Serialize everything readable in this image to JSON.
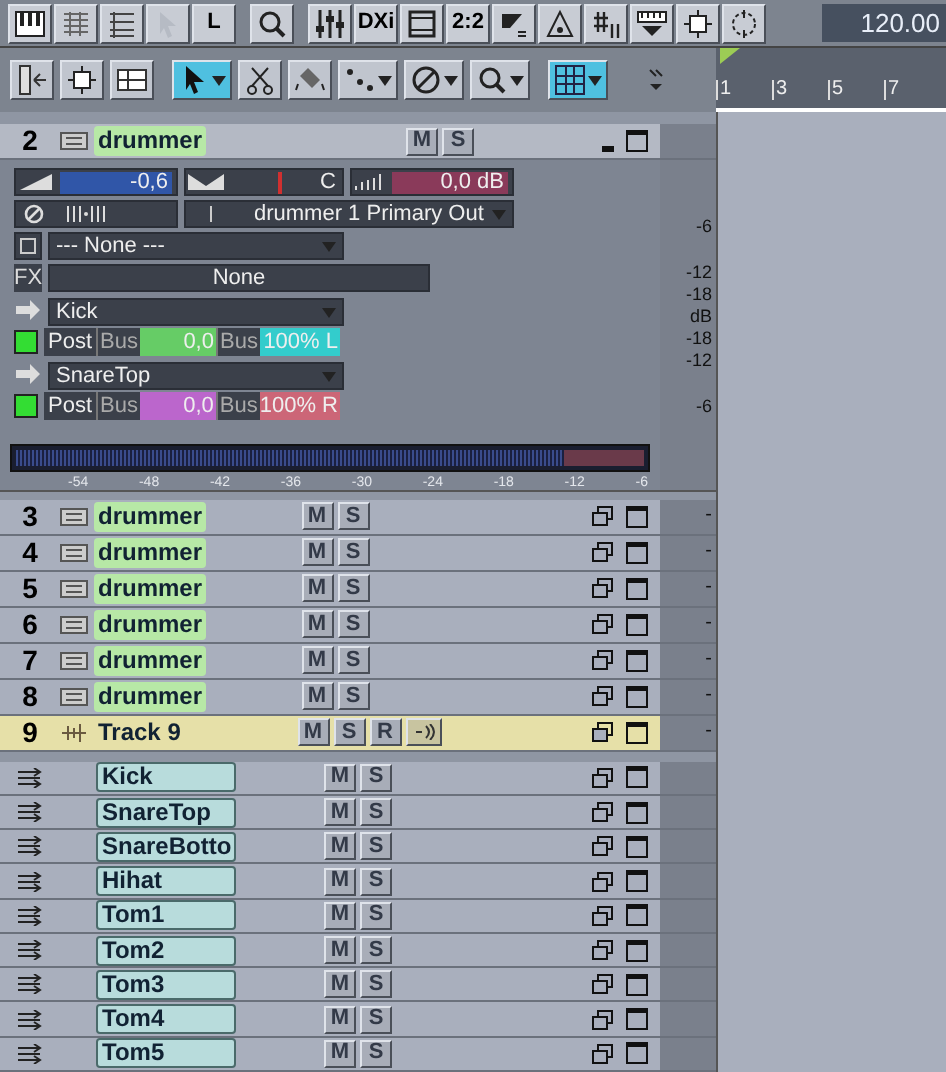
{
  "toolbar": {
    "buttons": [
      {
        "kind": "piano"
      },
      {
        "kind": "staff"
      },
      {
        "kind": "list"
      },
      {
        "kind": "faded-pointer"
      },
      {
        "kind": "text",
        "label": "L"
      },
      {
        "kind": "magnifier"
      },
      {
        "kind": "sliders"
      },
      {
        "kind": "text",
        "label": "DXi"
      },
      {
        "kind": "frame"
      },
      {
        "kind": "text",
        "label": "2:2"
      },
      {
        "kind": "ramp"
      },
      {
        "kind": "triangle"
      },
      {
        "kind": "sharp"
      },
      {
        "kind": "ruler"
      },
      {
        "kind": "move"
      },
      {
        "kind": "circle"
      }
    ],
    "tempo": "120.00"
  },
  "tools": [
    {
      "kind": "in-out",
      "selected": false,
      "dropdown": false
    },
    {
      "kind": "move",
      "selected": false,
      "dropdown": false
    },
    {
      "kind": "lanes",
      "selected": false,
      "dropdown": false
    },
    {
      "kind": "pointer",
      "selected": true,
      "dropdown": true
    },
    {
      "kind": "scissors",
      "selected": false,
      "dropdown": false
    },
    {
      "kind": "eraser",
      "selected": false,
      "dropdown": false
    },
    {
      "kind": "line",
      "selected": false,
      "dropdown": true
    },
    {
      "kind": "mute",
      "selected": false,
      "dropdown": true
    },
    {
      "kind": "magnifier",
      "selected": false,
      "dropdown": true
    },
    {
      "kind": "grid",
      "selected": true,
      "dropdown": true
    }
  ],
  "ruler": {
    "bars": [
      "1",
      "3",
      "5",
      "7"
    ]
  },
  "expanded_track": {
    "number": "2",
    "name": "drummer",
    "mute_label": "M",
    "solo_label": "S",
    "mute": false,
    "solo": false,
    "volume": "-0,6",
    "pan": "C",
    "trim": "0,0 dB",
    "output": "drummer 1 Primary Out",
    "input": "--- None ---",
    "fx_label": "FX",
    "fx": "None",
    "sends": [
      {
        "target": "Kick",
        "on": true,
        "mode": "Post",
        "bus": "Bus",
        "level": "0,0",
        "pan_bus": "Bus",
        "pan": "100% L",
        "color": "#66cc66"
      },
      {
        "target": "SnareTop",
        "on": true,
        "mode": "Post",
        "bus": "Bus",
        "level": "0,0",
        "pan_bus": "Bus",
        "pan": "100% R",
        "color": "#bb66cc"
      }
    ],
    "meter_ticks": [
      "-54",
      "-48",
      "-42",
      "-36",
      "-30",
      "-24",
      "-18",
      "-12",
      "-6"
    ]
  },
  "db_scale": [
    "-6",
    "-12",
    "-18",
    "dB",
    "-18",
    "-12",
    "-6"
  ],
  "tracks": [
    {
      "number": "3",
      "name": "drummer",
      "kind": "synth",
      "selected": false,
      "mute_label": "M",
      "solo_label": "S",
      "mute": false,
      "solo": false,
      "meter_mark": "-"
    },
    {
      "number": "4",
      "name": "drummer",
      "kind": "synth",
      "selected": false,
      "mute_label": "M",
      "solo_label": "S",
      "mute": false,
      "solo": false,
      "meter_mark": "-"
    },
    {
      "number": "5",
      "name": "drummer",
      "kind": "synth",
      "selected": false,
      "mute_label": "M",
      "solo_label": "S",
      "mute": false,
      "solo": false,
      "meter_mark": "-"
    },
    {
      "number": "6",
      "name": "drummer",
      "kind": "synth",
      "selected": false,
      "mute_label": "M",
      "solo_label": "S",
      "mute": false,
      "solo": false,
      "meter_mark": "-"
    },
    {
      "number": "7",
      "name": "drummer",
      "kind": "synth",
      "selected": false,
      "mute_label": "M",
      "solo_label": "S",
      "mute": false,
      "solo": false,
      "meter_mark": "-"
    },
    {
      "number": "8",
      "name": "drummer",
      "kind": "synth",
      "selected": false,
      "mute_label": "M",
      "solo_label": "S",
      "mute": false,
      "solo": false,
      "meter_mark": "-"
    },
    {
      "number": "9",
      "name": "Track 9",
      "kind": "audio",
      "selected": true,
      "mute_label": "M",
      "solo_label": "S",
      "record_label": "R",
      "mute": false,
      "solo": false,
      "record": false,
      "meter_mark": "-"
    }
  ],
  "buses": [
    {
      "name": "Kick",
      "mute_label": "M",
      "solo_label": "S",
      "mute": false,
      "solo": false
    },
    {
      "name": "SnareTop",
      "mute_label": "M",
      "solo_label": "S",
      "mute": false,
      "solo": false
    },
    {
      "name": "SnareBotto",
      "mute_label": "M",
      "solo_label": "S",
      "mute": false,
      "solo": false
    },
    {
      "name": "Hihat",
      "mute_label": "M",
      "solo_label": "S",
      "mute": false,
      "solo": false
    },
    {
      "name": "Tom1",
      "mute_label": "M",
      "solo_label": "S",
      "mute": false,
      "solo": false
    },
    {
      "name": "Tom2",
      "mute_label": "M",
      "solo_label": "S",
      "mute": false,
      "solo": false
    },
    {
      "name": "Tom3",
      "mute_label": "M",
      "solo_label": "S",
      "mute": false,
      "solo": false
    },
    {
      "name": "Tom4",
      "mute_label": "M",
      "solo_label": "S",
      "mute": false,
      "solo": false
    },
    {
      "name": "Tom5",
      "mute_label": "M",
      "solo_label": "S",
      "mute": false,
      "solo": false
    }
  ]
}
